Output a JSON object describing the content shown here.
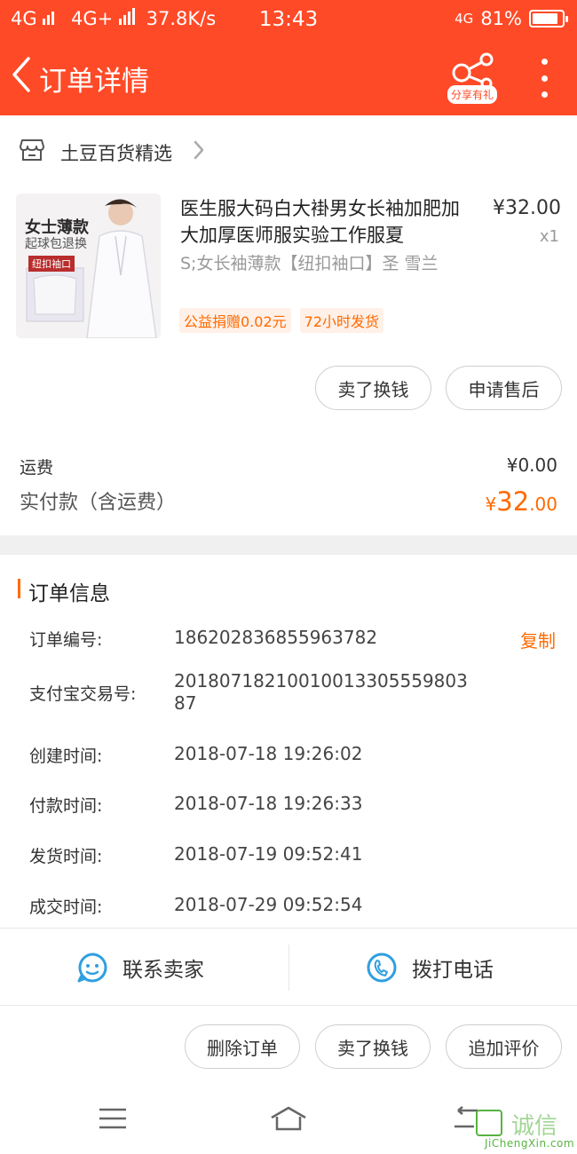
{
  "status_bar": {
    "net1": "4G",
    "net2": "4G+",
    "speed": "37.8K/s",
    "time": "13:43",
    "net3": "4G",
    "battery": "81%"
  },
  "header": {
    "title": "订单详情",
    "share_tag": "分享有礼"
  },
  "shop": {
    "name": "土豆百货精选"
  },
  "product": {
    "image_text_1": "女士薄款",
    "image_text_2": "起球包退换",
    "image_text_3": "纽扣袖口",
    "title": "医生服大码白大褂男女长袖加肥加大加厚医师服实验工作服夏",
    "price": "¥32.00",
    "qty": "x1",
    "sku": "S;女长袖薄款【纽扣袖口】圣 雪兰",
    "tags": [
      "公益捐赠0.02元",
      "72小时发货"
    ],
    "btn_resell": "卖了换钱",
    "btn_aftersale": "申请售后"
  },
  "fees": {
    "shipping_label": "运费",
    "shipping_value": "¥0.00",
    "paid_label": "实付款（含运费）",
    "paid_currency": "¥",
    "paid_int": "32",
    "paid_dec": ".00"
  },
  "order_info": {
    "title": "订单信息",
    "copy_label": "复制",
    "rows": [
      {
        "label": "订单编号:",
        "value": "186202836855963782"
      },
      {
        "label": "支付宝交易号:",
        "value": "20180718210010013305559803 87"
      },
      {
        "label": "创建时间:",
        "value": "2018-07-18 19:26:02"
      },
      {
        "label": "付款时间:",
        "value": "2018-07-18 19:26:33"
      },
      {
        "label": "发货时间:",
        "value": "2018-07-19 09:52:41"
      },
      {
        "label": "成交时间:",
        "value": "2018-07-29 09:52:54"
      }
    ]
  },
  "contact": {
    "seller": "联系卖家",
    "phone": "拨打电话"
  },
  "actions": {
    "delete": "删除订单",
    "resell": "卖了换钱",
    "review": "追加评价"
  },
  "watermark": {
    "text": "诚信",
    "url": "JiChengXin.com"
  },
  "colors": {
    "brand": "#ff4a27",
    "accent": "#ff6a00",
    "link_blue": "#2f9fe0"
  }
}
